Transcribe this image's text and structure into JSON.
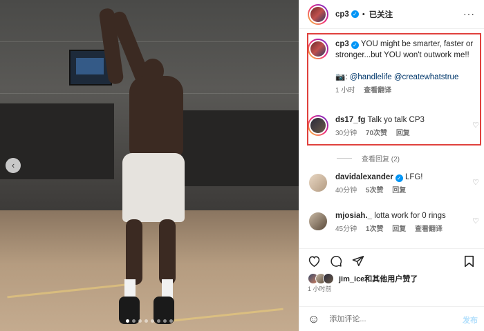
{
  "photo": {
    "carousel_dots": 8,
    "active_dot": 0,
    "prev_label": "‹"
  },
  "header": {
    "username": "cp3",
    "separator": "•",
    "follow_state": "已关注",
    "more_label": "···"
  },
  "caption": {
    "username": "cp3",
    "text": "YOU might be smarter, faster or stronger...but YOU won't outwork me!!",
    "tag_prefix": "📷:",
    "tag1": "@handlelife",
    "tag2": "@createwhatstrue",
    "time": "1 小时",
    "translate": "查看翻译"
  },
  "comments": [
    {
      "username": "ds17_fg",
      "text": "Talk yo talk CP3",
      "time": "30分钟",
      "likes": "70次赞",
      "reply": "回复",
      "verified": false
    },
    {
      "username": "davidalexander",
      "text": "LFG!",
      "time": "40分钟",
      "likes": "5次赞",
      "reply": "回复",
      "verified": true
    },
    {
      "username": "mjosiah._",
      "text": "lotta work for 0 rings",
      "time": "45分钟",
      "likes": "1次赞",
      "reply": "回复",
      "translate": "查看翻译",
      "verified": false
    }
  ],
  "view_replies": "查看回复 (2)",
  "actions": {
    "like_icon": "heart-icon",
    "comment_icon": "comment-icon",
    "share_icon": "share-icon",
    "save_icon": "bookmark-icon"
  },
  "likes_text": "jim_ice和其他用户赞了",
  "posted_ago": "1 小时前",
  "add_comment": {
    "placeholder": "添加评论...",
    "post_label": "发布"
  },
  "colors": {
    "verified": "#0095f6",
    "highlight_box": "#e0403c",
    "link": "#00376b"
  }
}
